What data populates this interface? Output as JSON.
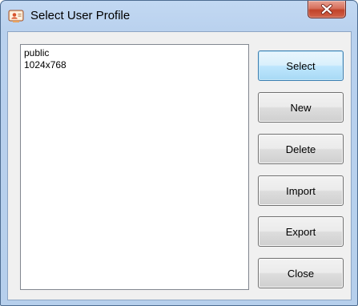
{
  "window": {
    "title": "Select User Profile",
    "app_icon": "profile-card-icon",
    "close_icon": "close-x-icon"
  },
  "profiles": [
    "public",
    "1024x768"
  ],
  "buttons": {
    "select": "Select",
    "new": "New",
    "delete": "Delete",
    "import": "Import",
    "export": "Export",
    "close": "Close"
  },
  "colors": {
    "titlebar": "#b9d1ee",
    "close_button": "#c1432a",
    "default_button": "#bee6fd"
  }
}
